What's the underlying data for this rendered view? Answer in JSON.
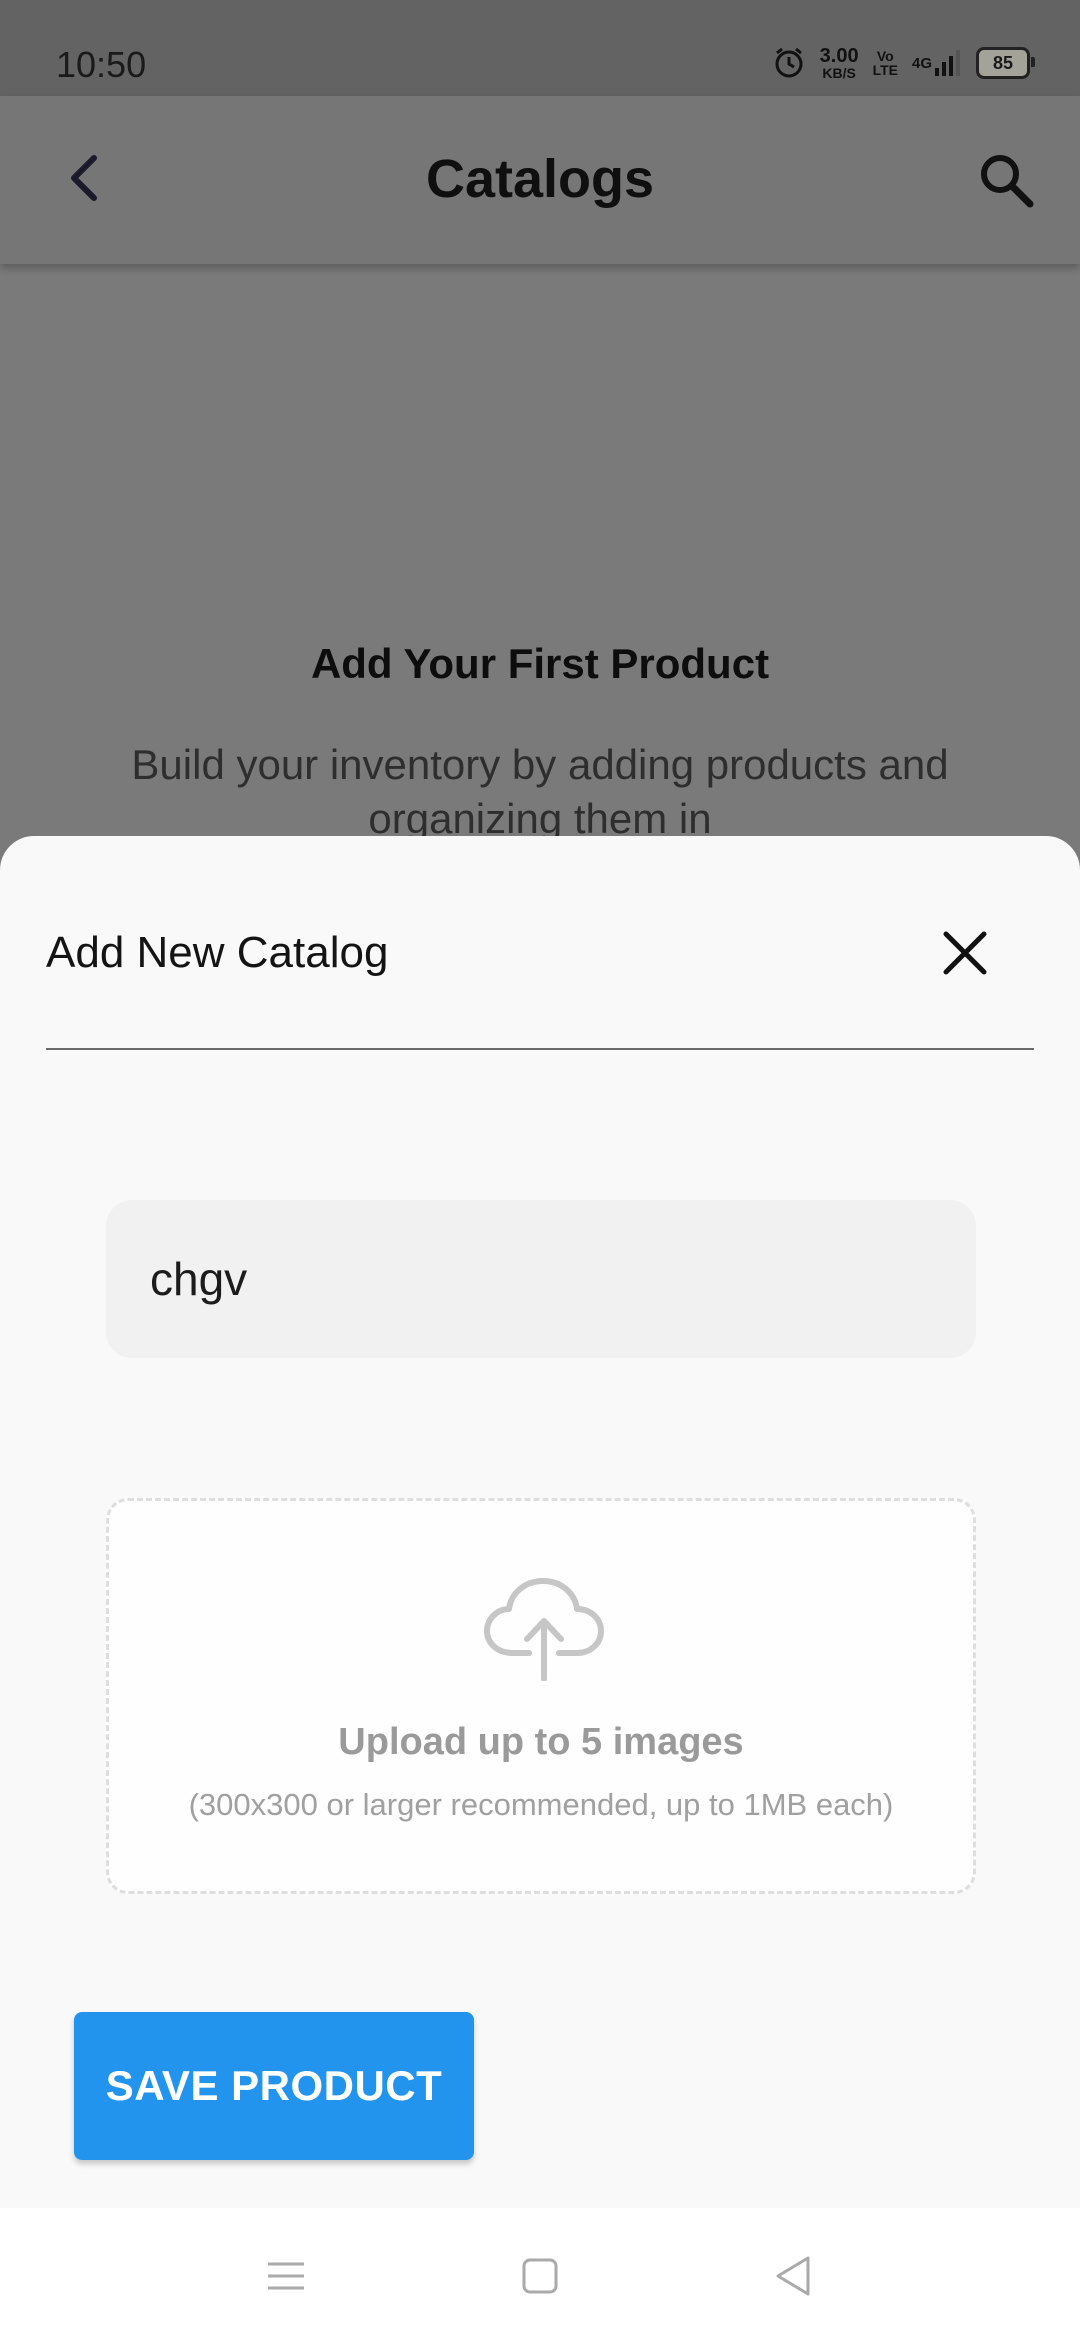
{
  "status_bar": {
    "time": "10:50",
    "speed_value": "3.00",
    "speed_unit": "KB/S",
    "volte_top": "Vo",
    "volte_bottom": "LTE",
    "network": "4G",
    "battery": "85",
    "icons": [
      "alarm-icon",
      "signal-icon",
      "battery-icon"
    ]
  },
  "app_bar": {
    "title": "Catalogs",
    "icons": [
      "back-arrow-icon",
      "search-icon"
    ]
  },
  "empty_state": {
    "title": "Add Your First Product",
    "description": "Build your inventory by adding products and organizing them in"
  },
  "sheet": {
    "title": "Add New Catalog",
    "close_icon": "close-icon",
    "name_value": "chgv",
    "upload": {
      "icon": "cloud-upload-icon",
      "title": "Upload up to 5 images",
      "note": "(300x300 or larger recommended, up to 1MB each)"
    },
    "save_label": "SAVE PRODUCT",
    "accent_color": "#2294ee"
  },
  "nav_bar": {
    "icons": [
      "menu-icon",
      "home-square-icon",
      "back-triangle-icon"
    ]
  }
}
